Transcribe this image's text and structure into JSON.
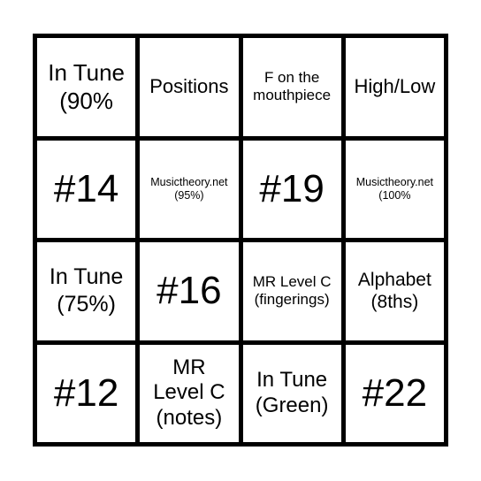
{
  "board": {
    "cells": [
      {
        "text": "In Tune (90%",
        "size": "l"
      },
      {
        "text": "Positions",
        "size": "m"
      },
      {
        "text": "F on the mouthpiece",
        "size": "sm"
      },
      {
        "text": "High/Low",
        "size": "m"
      },
      {
        "text": "#14",
        "size": "xl"
      },
      {
        "text": "Musictheory.net (95%)",
        "size": "xs"
      },
      {
        "text": "#19",
        "size": "xl"
      },
      {
        "text": "Musictheory.net (100%",
        "size": "xs"
      },
      {
        "text": "In Tune (75%)",
        "size": "l"
      },
      {
        "text": "#16",
        "size": "xl"
      },
      {
        "text": "MR Level C (fingerings)",
        "size": "sm"
      },
      {
        "text": "Alphabet (8ths)",
        "size": "m"
      },
      {
        "text": "#12",
        "size": "xl"
      },
      {
        "text": "MR Level C (notes)",
        "size": "m"
      },
      {
        "text": "In Tune (Green)",
        "size": "m"
      },
      {
        "text": "#22",
        "size": "xl"
      }
    ]
  }
}
